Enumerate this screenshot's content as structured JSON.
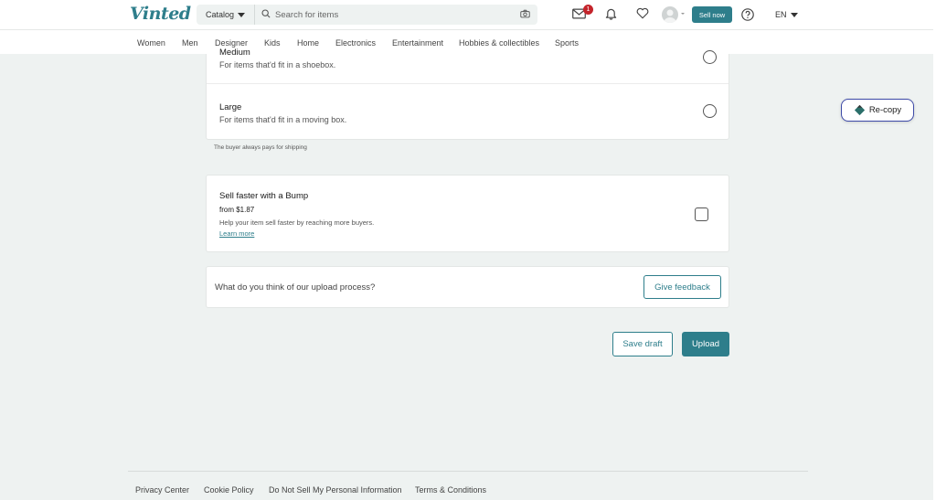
{
  "header": {
    "logo": "Vinted",
    "catalog_label": "Catalog",
    "search_placeholder": "Search for items",
    "inbox_badge": "1",
    "sell_label": "Sell now",
    "language": "EN"
  },
  "categories": [
    "Women",
    "Men",
    "Designer",
    "Kids",
    "Home",
    "Electronics",
    "Entertainment",
    "Hobbies & collectibles",
    "Sports"
  ],
  "package_sizes": [
    {
      "title": "Medium",
      "description": "For items that'd fit in a shoebox."
    },
    {
      "title": "Large",
      "description": "For items that'd fit in a moving box."
    }
  ],
  "shipping_note": "The buyer always pays for shipping",
  "bump": {
    "title": "Sell faster with a Bump",
    "price": "from $1.87",
    "description": "Help your item sell faster by reaching more buyers.",
    "link": "Learn more"
  },
  "feedback": {
    "question": "What do you think of our upload process?",
    "button": "Give feedback"
  },
  "actions": {
    "save_draft": "Save draft",
    "upload": "Upload"
  },
  "recopy_label": "Re-copy",
  "footer_links": [
    "Privacy Center",
    "Cookie Policy",
    "Do Not Sell My Personal Information",
    "Terms & Conditions"
  ],
  "colors": {
    "brand": "#2e7e8b",
    "badge": "#c4242b",
    "background": "#eef2f1"
  }
}
